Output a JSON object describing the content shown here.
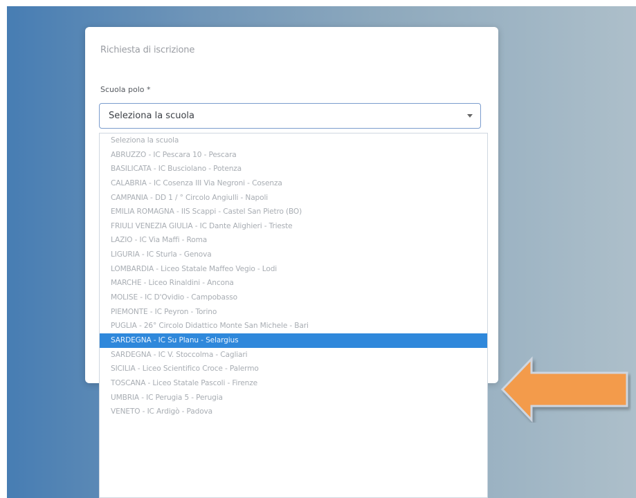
{
  "form": {
    "title": "Richiesta di iscrizione",
    "field_label": "Scuola polo *",
    "select_value": "Seleziona la scuola"
  },
  "dropdown": {
    "options": [
      "Seleziona la scuola",
      "ABRUZZO - IC Pescara 10 - Pescara",
      "BASILICATA - IC Busciolano - Potenza",
      "CALABRIA - IC Cosenza III Via Negroni - Cosenza",
      "CAMPANIA - DD 1 / ° Circolo Angiulli - Napoli",
      "EMILIA ROMAGNA - IIS Scappi - Castel San Pietro (BO)",
      "FRIULI VENEZIA GIULIA - IC Dante Alighieri - Trieste",
      "LAZIO - IC Via Maffi - Roma",
      "LIGURIA - IC Sturla - Genova",
      "LOMBARDIA - Liceo Statale Maffeo Vegio - Lodi",
      "MARCHE - Liceo Rinaldini - Ancona",
      "MOLISE - IC D'Ovidio - Campobasso",
      "PIEMONTE - IC Peyron - Torino",
      "PUGLIA - 26° Circolo Didattico Monte San Michele - Bari",
      "SARDEGNA - IC Su Planu - Selargius",
      "SARDEGNA - IC V. Stoccolma - Cagliari",
      "SICILIA - Liceo Scientifico Croce - Palermo",
      "TOSCANA - Liceo Statale Pascoli - Firenze",
      "UMBRIA - IC Perugia 5 - Perugia",
      "VENETO - IC Ardigò - Padova"
    ],
    "selected_index": 14
  },
  "icons": {
    "select": "chevron-down-icon",
    "pointer": "left-arrow-icon"
  },
  "colors": {
    "highlight": "#2f88db",
    "arrow_fill": "#f39b4b"
  }
}
